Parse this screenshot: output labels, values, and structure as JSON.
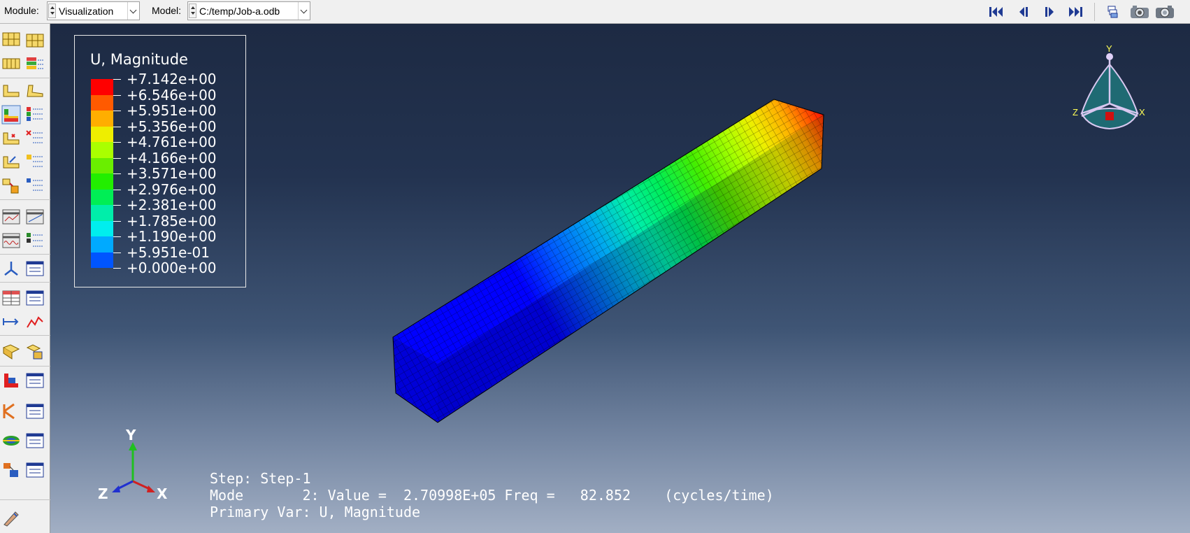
{
  "toolbar": {
    "module_label": "Module:",
    "module_value": "Visualization",
    "model_label": "Model:",
    "model_value": "C:/temp/Job-a.odb"
  },
  "legend": {
    "title": "U, Magnitude",
    "entries": [
      {
        "label": "+7.142e+00",
        "color": "#ff0000"
      },
      {
        "label": "+6.546e+00",
        "color": "#ff5a00"
      },
      {
        "label": "+5.951e+00",
        "color": "#ffae00"
      },
      {
        "label": "+5.356e+00",
        "color": "#eeee00"
      },
      {
        "label": "+4.761e+00",
        "color": "#aaff00"
      },
      {
        "label": "+4.166e+00",
        "color": "#6aee00"
      },
      {
        "label": "+3.571e+00",
        "color": "#22ee00"
      },
      {
        "label": "+2.976e+00",
        "color": "#00ee55"
      },
      {
        "label": "+2.381e+00",
        "color": "#00eeaa"
      },
      {
        "label": "+1.785e+00",
        "color": "#00eeee"
      },
      {
        "label": "+1.190e+00",
        "color": "#00aaff"
      },
      {
        "label": "+5.951e-01",
        "color": "#0055ff"
      },
      {
        "label": "+0.000e+00",
        "color": "#0000ff"
      }
    ]
  },
  "info": {
    "step": "Step: Step-1",
    "mode": "Mode       2: Value =  2.70998E+05 Freq =   82.852    (cycles/time)",
    "primary_var": "Primary Var: U, Magnitude"
  },
  "triad": {
    "y": "Y",
    "z": "Z",
    "x": "X"
  },
  "compass": {
    "y": "Y",
    "z": "Z",
    "x": "X"
  },
  "colors": {
    "accent_blue": "#1f3a93",
    "background_top": "#1d2a43",
    "background_bottom": "#a2afc4"
  }
}
